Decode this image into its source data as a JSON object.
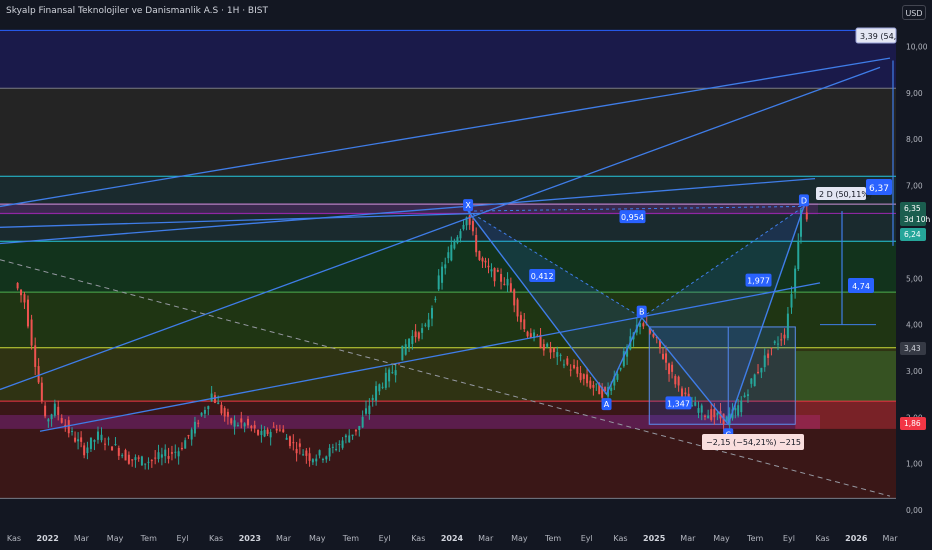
{
  "header": {
    "title": "Skyalp Finansal Teknolojiler ve Danismanlik A.S · 1H · BIST",
    "currency": "USD"
  },
  "chart_data": {
    "type": "line",
    "y_ticks": [
      "0,00",
      "1,00",
      "2,00",
      "3,00",
      "4,00",
      "5,00",
      "6,00",
      "7,00",
      "8,00",
      "9,00",
      "10,00"
    ],
    "y_range": [
      0,
      10.4
    ],
    "x_ticks": [
      "Kas",
      "2022",
      "Mar",
      "May",
      "Tem",
      "Eyl",
      "Kas",
      "2023",
      "Mar",
      "May",
      "Tem",
      "Eyl",
      "Kas",
      "2024",
      "Mar",
      "May",
      "Tem",
      "Eyl",
      "Kas",
      "2025",
      "Mar",
      "May",
      "Tem",
      "Eyl",
      "Kas",
      "2026",
      "Mar"
    ],
    "year_ticks": [
      "2022",
      "2023",
      "2024",
      "2025",
      "2026"
    ],
    "price_points": [
      {
        "t": "2021-11-01",
        "p": 4.9
      },
      {
        "t": "2021-11-20",
        "p": 4.5
      },
      {
        "t": "2021-12-10",
        "p": 3.2
      },
      {
        "t": "2021-12-28",
        "p": 1.9
      },
      {
        "t": "2022-01-15",
        "p": 2.2
      },
      {
        "t": "2022-02-10",
        "p": 1.7
      },
      {
        "t": "2022-03-10",
        "p": 1.3
      },
      {
        "t": "2022-04-05",
        "p": 1.6
      },
      {
        "t": "2022-05-01",
        "p": 1.4
      },
      {
        "t": "2022-06-01",
        "p": 1.1
      },
      {
        "t": "2022-07-01",
        "p": 1.05
      },
      {
        "t": "2022-08-01",
        "p": 1.15
      },
      {
        "t": "2022-09-01",
        "p": 1.3
      },
      {
        "t": "2022-10-01",
        "p": 1.8
      },
      {
        "t": "2022-11-01",
        "p": 2.5
      },
      {
        "t": "2022-12-01",
        "p": 1.9
      },
      {
        "t": "2023-01-01",
        "p": 1.85
      },
      {
        "t": "2023-02-01",
        "p": 1.6
      },
      {
        "t": "2023-03-01",
        "p": 1.8
      },
      {
        "t": "2023-04-01",
        "p": 1.4
      },
      {
        "t": "2023-05-01",
        "p": 1.15
      },
      {
        "t": "2023-06-01",
        "p": 1.2
      },
      {
        "t": "2023-07-01",
        "p": 1.5
      },
      {
        "t": "2023-08-01",
        "p": 1.8
      },
      {
        "t": "2023-09-01",
        "p": 2.6
      },
      {
        "t": "2023-10-01",
        "p": 3.0
      },
      {
        "t": "2023-11-01",
        "p": 3.7
      },
      {
        "t": "2023-12-01",
        "p": 3.9
      },
      {
        "t": "2024-01-01",
        "p": 5.2
      },
      {
        "t": "2024-02-15",
        "p": 6.4
      },
      {
        "t": "2024-03-10",
        "p": 5.4
      },
      {
        "t": "2024-04-01",
        "p": 5.1
      },
      {
        "t": "2024-05-01",
        "p": 4.9
      },
      {
        "t": "2024-06-01",
        "p": 3.9
      },
      {
        "t": "2024-07-01",
        "p": 3.6
      },
      {
        "t": "2024-08-01",
        "p": 3.3
      },
      {
        "t": "2024-09-01",
        "p": 3.0
      },
      {
        "t": "2024-10-01",
        "p": 2.7
      },
      {
        "t": "2024-10-28",
        "p": 2.5
      },
      {
        "t": "2024-11-20",
        "p": 3.0
      },
      {
        "t": "2025-01-01",
        "p": 4.1
      },
      {
        "t": "2025-02-01",
        "p": 3.6
      },
      {
        "t": "2025-03-01",
        "p": 2.9
      },
      {
        "t": "2025-04-01",
        "p": 2.3
      },
      {
        "t": "2025-05-01",
        "p": 2.1
      },
      {
        "t": "2025-06-10",
        "p": 1.95
      },
      {
        "t": "2025-07-01",
        "p": 2.2
      },
      {
        "t": "2025-08-01",
        "p": 2.9
      },
      {
        "t": "2025-09-01",
        "p": 3.5
      },
      {
        "t": "2025-09-25",
        "p": 3.8
      },
      {
        "t": "2025-10-15",
        "p": 5.2
      },
      {
        "t": "2025-10-25",
        "p": 6.6
      },
      {
        "t": "2025-11-05",
        "p": 6.35
      }
    ],
    "horizontal_levels": [
      {
        "price": 10.35,
        "color": "#2962ff",
        "style": "fill-top"
      },
      {
        "price": 9.1,
        "color": "#787b86"
      },
      {
        "price": 7.2,
        "color": "#26c6da"
      },
      {
        "price": 6.6,
        "color": "#ce93d8"
      },
      {
        "price": 6.4,
        "color": "#9c27b0"
      },
      {
        "price": 5.8,
        "color": "#26c6da"
      },
      {
        "price": 4.7,
        "color": "#4caf50"
      },
      {
        "price": 3.5,
        "color": "#cddc39"
      },
      {
        "price": 2.35,
        "color": "#f23645"
      },
      {
        "price": 0.25,
        "color": "#787b86"
      }
    ],
    "zones": [
      {
        "from": 9.1,
        "to": 10.35,
        "color": "#1a1a4a"
      },
      {
        "from": 7.2,
        "to": 9.1,
        "color": "#242424"
      },
      {
        "from": 5.8,
        "to": 7.2,
        "color": "#1a2a2e"
      },
      {
        "from": 4.7,
        "to": 5.8,
        "color": "#12331c"
      },
      {
        "from": 3.5,
        "to": 4.7,
        "color": "#1f3513"
      },
      {
        "from": 2.35,
        "to": 3.5,
        "color": "#2f3313"
      },
      {
        "from": 0.25,
        "to": 2.35,
        "color": "#3a1717"
      }
    ],
    "pattern_points": [
      {
        "label": "X",
        "t": "2024-02-15",
        "p": 6.45
      },
      {
        "label": "A",
        "t": "2024-10-28",
        "p": 2.5
      },
      {
        "label": "B",
        "t": "2025-01-01",
        "p": 4.15
      },
      {
        "label": "C",
        "t": "2025-06-10",
        "p": 1.85
      },
      {
        "label": "D",
        "t": "2025-10-28",
        "p": 6.55
      }
    ],
    "ratio_labels": [
      {
        "text": "0,954",
        "t": "2024-12-15",
        "p": 6.32
      },
      {
        "text": "0,412",
        "t": "2024-07-01",
        "p": 5.05
      },
      {
        "text": "1,977",
        "t": "2025-08-05",
        "p": 4.95
      },
      {
        "text": "1,347",
        "t": "2025-03-10",
        "p": 2.3
      }
    ],
    "annotations": {
      "top_target": "3,39 (54,11",
      "drop_label": "−2,15 (−54,21%) −215",
      "d_box": "2 D (50,11%)",
      "target_637": "6,37",
      "mid_474": "4,74",
      "price_last": "6,35",
      "countdown": "3d 10h",
      "price_624": "6,24",
      "price_343": "3,43",
      "price_186": "1,86"
    },
    "colors": {
      "background": "#131722",
      "pattern": "#3f7de8",
      "label_fill": "#2962ff",
      "bull": "#26a69a",
      "bear": "#ef5350",
      "axis_text": "#b2b5be",
      "dashed": "#9598a1"
    }
  }
}
